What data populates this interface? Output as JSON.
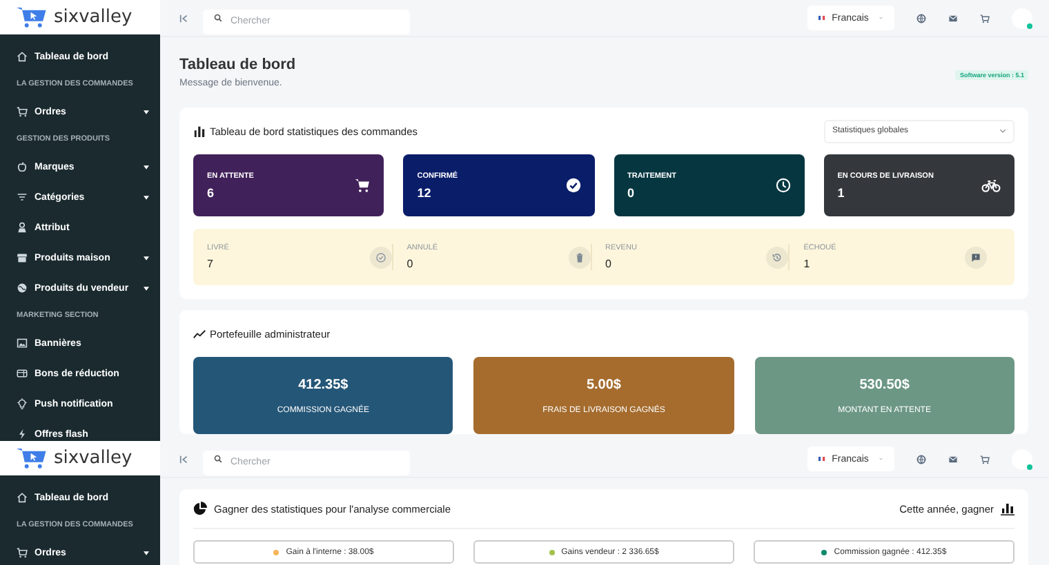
{
  "screens": [
    {
      "brand": "sixvalley",
      "search": {
        "placeholder": "Chercher"
      },
      "language": "Francais",
      "sidebar": [
        {
          "kind": "link",
          "label": "Tableau de bord",
          "expandable": false
        },
        {
          "kind": "section",
          "label": "LA GESTION DES COMMANDES"
        },
        {
          "kind": "link",
          "label": "Ordres",
          "expandable": true
        },
        {
          "kind": "section",
          "label": "GESTION DES PRODUITS"
        },
        {
          "kind": "link",
          "label": "Marques",
          "expandable": true
        },
        {
          "kind": "link",
          "label": "Catégories",
          "expandable": true
        },
        {
          "kind": "link",
          "label": "Attribut",
          "expandable": false
        },
        {
          "kind": "link",
          "label": "Produits maison",
          "expandable": true
        },
        {
          "kind": "link",
          "label": "Produits du vendeur",
          "expandable": true
        },
        {
          "kind": "section",
          "label": "MARKETING SECTION"
        },
        {
          "kind": "link",
          "label": "Bannières",
          "expandable": false
        },
        {
          "kind": "link",
          "label": "Bons de réduction",
          "expandable": false
        },
        {
          "kind": "link",
          "label": "Push notification",
          "expandable": false
        },
        {
          "kind": "link",
          "label": "Offres flash",
          "expandable": false
        }
      ],
      "page": {
        "title": "Tableau de bord",
        "subtitle": "Message de bienvenue.",
        "version": "Software version : 5.1",
        "order_stats": {
          "title": "Tableau de bord statistiques des commandes",
          "filter": "Statistiques globales",
          "statuses": [
            {
              "label": "EN ATTENTE",
              "value": "6",
              "color": "#41215a"
            },
            {
              "label": "CONFIRMÉ",
              "value": "12",
              "color": "#0a1d69"
            },
            {
              "label": "TRAITEMENT",
              "value": "0",
              "color": "#063741"
            },
            {
              "label": "EN COURS DE LIVRAISON",
              "value": "1",
              "color": "#34383c"
            }
          ],
          "secondary": [
            {
              "label": "LIVRÉ",
              "value": "7"
            },
            {
              "label": "ANNULÉ",
              "value": "0"
            },
            {
              "label": "REVENU",
              "value": "0"
            },
            {
              "label": "ÉCHOUÉ",
              "value": "1"
            }
          ]
        },
        "wallet": {
          "title": "Portefeuille administrateur",
          "cards": [
            {
              "amount": "412.35$",
              "label": "COMMISSION GAGNÉE",
              "color": "#245677"
            },
            {
              "amount": "5.00$",
              "label": "FRAIS DE LIVRAISON GAGNÉS",
              "color": "#a56c2e"
            },
            {
              "amount": "530.50$",
              "label": "MONTANT EN ATTENTE",
              "color": "#6c9785"
            }
          ]
        }
      }
    },
    {
      "brand": "sixvalley",
      "search": {
        "placeholder": "Chercher"
      },
      "language": "Francais",
      "sidebar": [
        {
          "kind": "link",
          "label": "Tableau de bord",
          "expandable": false
        },
        {
          "kind": "section",
          "label": "LA GESTION DES COMMANDES"
        },
        {
          "kind": "link",
          "label": "Ordres",
          "expandable": true
        }
      ],
      "earnings": {
        "title": "Gagner des statistiques pour l'analyse commerciale",
        "period": "Cette année, gagner",
        "legend": [
          {
            "label": "Gain à l'interne : 38.00$",
            "color": "#f8b65a"
          },
          {
            "label": "Gains vendeur : 2 336.65$",
            "color": "#a3c24c"
          },
          {
            "label": "Commission gagnée : 412.35$",
            "color": "#0f8a6c"
          }
        ]
      }
    }
  ]
}
